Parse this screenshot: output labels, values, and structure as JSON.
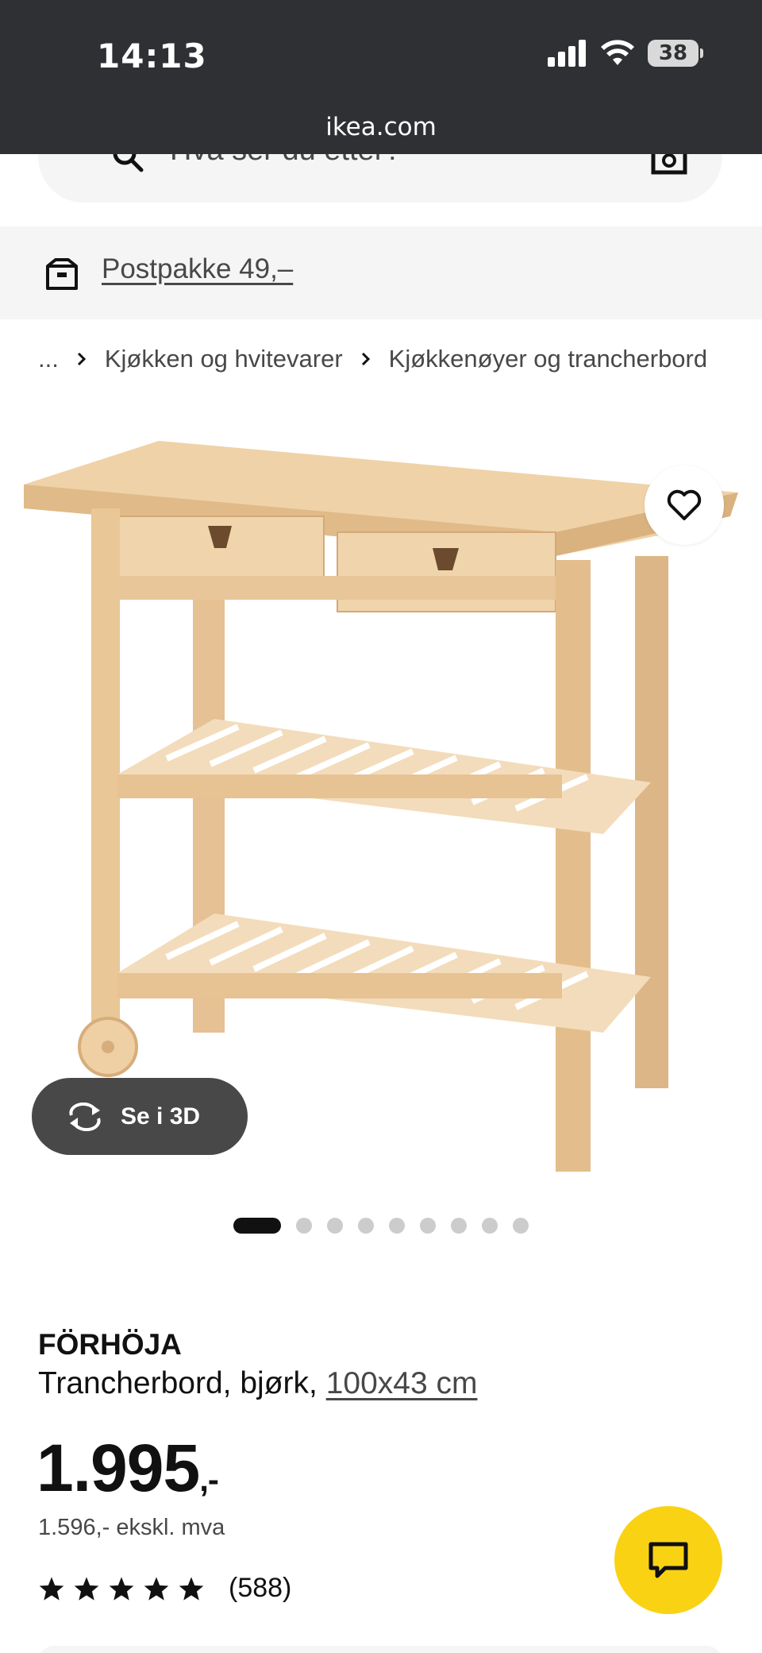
{
  "status": {
    "time": "14:13",
    "battery": "38",
    "url": "ikea.com"
  },
  "search": {
    "placeholder": "Hva ser du etter?"
  },
  "delivery": {
    "label": "Postpakke 49,–"
  },
  "breadcrumb": {
    "ellipsis": "...",
    "items": [
      "Kjøkken og hvitevarer",
      "Kjøkkenøyer og trancherbord"
    ]
  },
  "gallery": {
    "view3d_label": "Se i 3D",
    "dot_count": 9,
    "active_index": 0
  },
  "product": {
    "name": "FÖRHÖJA",
    "description": "Trancherbord, bjørk, ",
    "size": "100x43 cm",
    "price_main": "1.995",
    "price_suffix": ",-",
    "price_ex_vat": "1.596,- ekskl. mva",
    "rating": {
      "stars": 5,
      "max": 5,
      "count": "(588)"
    }
  },
  "colors": {
    "chat": "#fad214",
    "dark": "#111111",
    "statusbar": "#2e3033"
  }
}
